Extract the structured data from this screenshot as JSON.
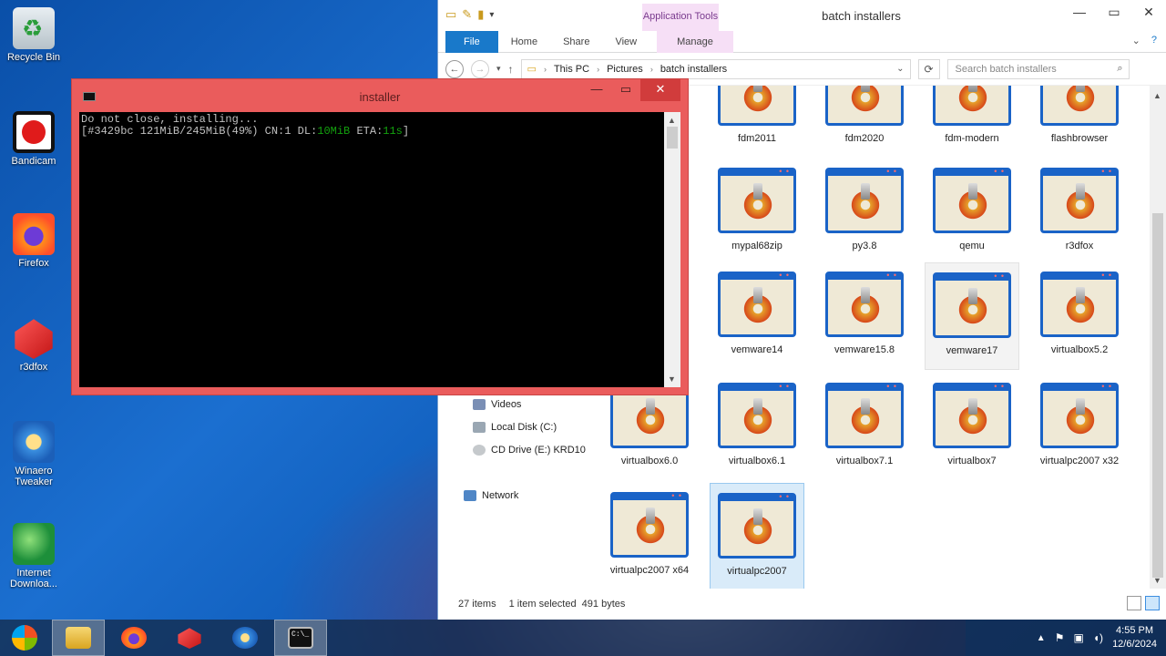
{
  "desktop": {
    "icons": [
      {
        "label": "Recycle Bin",
        "icon": "recycle-bin-icon"
      },
      {
        "label": "Bandicam",
        "icon": "bandicam-icon"
      },
      {
        "label": "Firefox",
        "icon": "firefox-icon"
      },
      {
        "label": "r3dfox",
        "icon": "r3dfox-icon"
      },
      {
        "label": "Winaero Tweaker",
        "icon": "winaero-icon"
      },
      {
        "label": "Internet Downloa...",
        "icon": "idm-icon"
      }
    ]
  },
  "explorer": {
    "title": "batch installers",
    "app_tools_label": "Application Tools",
    "tabs": [
      "File",
      "Home",
      "Share",
      "View",
      "Manage"
    ],
    "breadcrumb": [
      "This PC",
      "Pictures",
      "batch installers"
    ],
    "search_placeholder": "Search batch installers",
    "nav_items": [
      {
        "label": "Videos"
      },
      {
        "label": "Local Disk (C:)"
      },
      {
        "label": "CD Drive (E:) KRD10"
      },
      {
        "label": "Network"
      }
    ],
    "files": [
      "fdm2011",
      "fdm2020",
      "fdm-modern",
      "flashbrowser",
      "mypal68zip",
      "py3.8",
      "qemu",
      "r3dfox",
      "vemware14",
      "vemware15.8",
      "vemware17",
      "virtualbox5.2",
      "virtualbox6.0",
      "virtualbox6.1",
      "virtualbox7.1",
      "virtualbox7",
      "virtualpc2007 x32",
      "virtualpc2007 x64",
      "virtualpc2007"
    ],
    "status": {
      "count": "27 items",
      "selection": "1 item selected  491 bytes"
    }
  },
  "console": {
    "title": "installer",
    "line1": "Do not close, installing...",
    "line2_prefix": "[#3429bc 121MiB/245MiB(49%) CN:1 DL:",
    "dl_speed": "10MiB",
    "eta_label": " ETA:",
    "eta_value": "11s",
    "line2_suffix": "]"
  },
  "taskbar": {
    "clock_time": "4:55 PM",
    "clock_date": "12/6/2024"
  }
}
